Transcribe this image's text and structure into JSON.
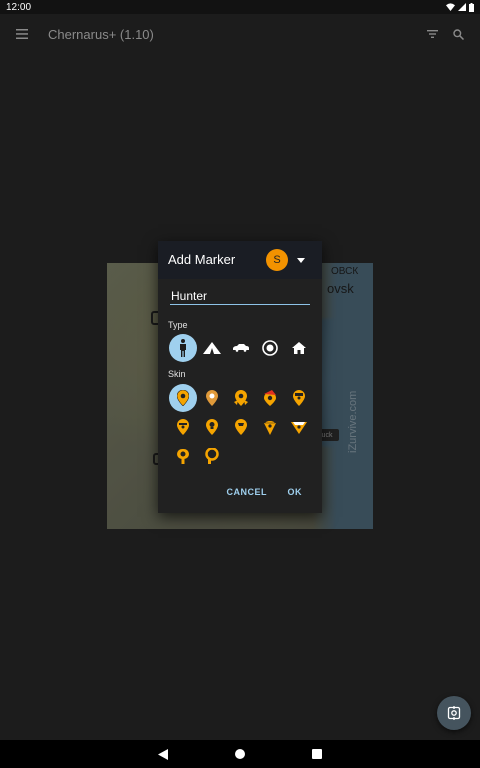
{
  "status_bar": {
    "time": "12:00"
  },
  "app_bar": {
    "title": "Chernarus+ (1.10)"
  },
  "map": {
    "label_top": "ОВСК",
    "label_city": "ovsk",
    "tag": "uck",
    "watermark": "iZurvive.com"
  },
  "dialog": {
    "title": "Add Marker",
    "avatar_letter": "S",
    "name_value": "Hunter",
    "type_label": "Type",
    "skin_label": "Skin",
    "types": [
      {
        "name": "person-icon",
        "selected": true
      },
      {
        "name": "tent-icon",
        "selected": false
      },
      {
        "name": "car-icon",
        "selected": false
      },
      {
        "name": "target-icon",
        "selected": false
      },
      {
        "name": "house-icon",
        "selected": false
      }
    ],
    "skins_count": 12,
    "cancel_label": "CANCEL",
    "ok_label": "OK"
  },
  "colors": {
    "accent": "#9fd0ee",
    "avatar": "#f29200",
    "marker_orange": "#f5a400",
    "dialog_header": "#1a1d24"
  }
}
